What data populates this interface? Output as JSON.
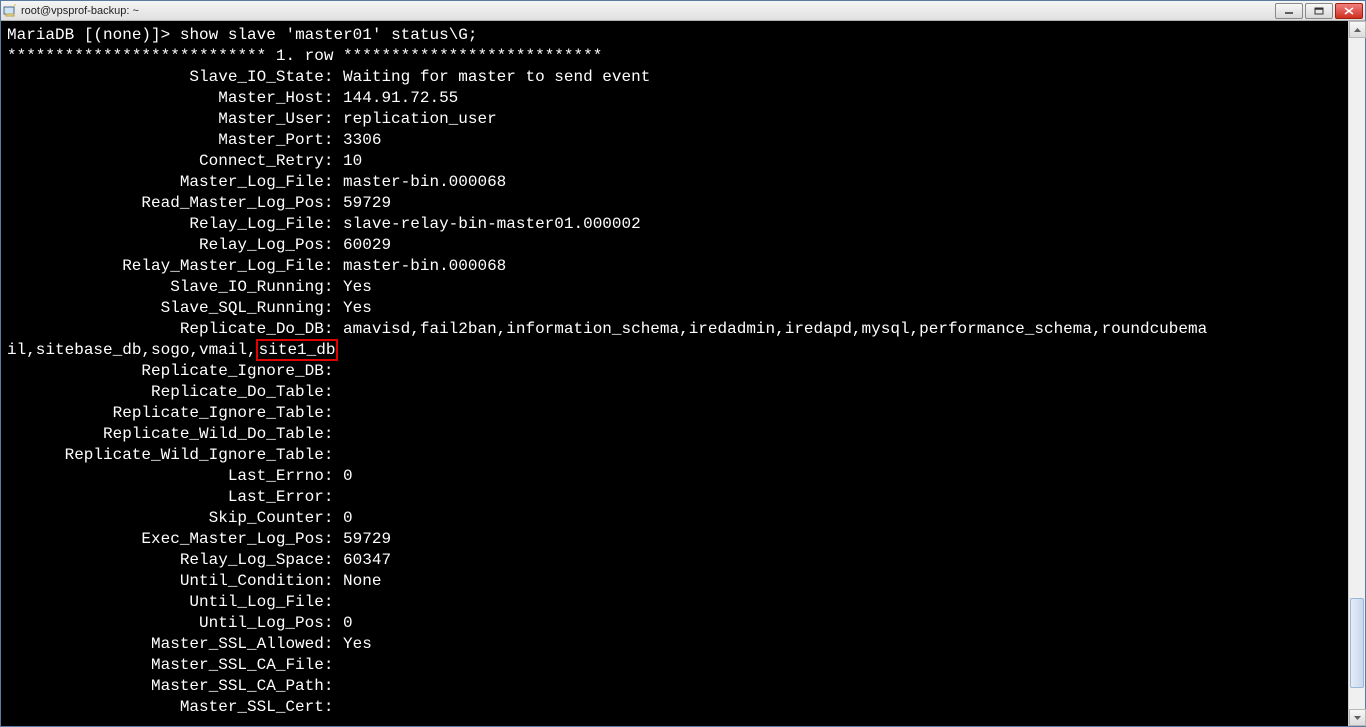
{
  "window": {
    "title": "root@vpsprof-backup: ~"
  },
  "prompt": {
    "label": "MariaDB [(none)]>",
    "command": "show slave 'master01' status\\G;"
  },
  "row_separator": "*************************** 1. row ***************************",
  "replicate_do_db_prefix": "amavisd,fail2ban,information_schema,iredadmin,iredapd,mysql,performance_schema,roundcubema",
  "replicate_do_db_wrap": "il,sitebase_db,sogo,vmail,",
  "replicate_do_db_highlight": "site1_db",
  "fields": {
    "Slave_IO_State": "Waiting for master to send event",
    "Master_Host": "144.91.72.55",
    "Master_User": "replication_user",
    "Master_Port": "3306",
    "Connect_Retry": "10",
    "Master_Log_File": "master-bin.000068",
    "Read_Master_Log_Pos": "59729",
    "Relay_Log_File": "slave-relay-bin-master01.000002",
    "Relay_Log_Pos": "60029",
    "Relay_Master_Log_File": "master-bin.000068",
    "Slave_IO_Running": "Yes",
    "Slave_SQL_Running": "Yes",
    "Replicate_Do_DB_key": "Replicate_Do_DB",
    "Replicate_Ignore_DB": "",
    "Replicate_Do_Table": "",
    "Replicate_Ignore_Table": "",
    "Replicate_Wild_Do_Table": "",
    "Replicate_Wild_Ignore_Table": "",
    "Last_Errno": "0",
    "Last_Error": "",
    "Skip_Counter": "0",
    "Exec_Master_Log_Pos": "59729",
    "Relay_Log_Space": "60347",
    "Until_Condition": "None",
    "Until_Log_File": "",
    "Until_Log_Pos": "0",
    "Master_SSL_Allowed": "Yes",
    "Master_SSL_CA_File": "",
    "Master_SSL_CA_Path": "",
    "Master_SSL_Cert": ""
  },
  "labels": {
    "Slave_IO_State": "Slave_IO_State",
    "Master_Host": "Master_Host",
    "Master_User": "Master_User",
    "Master_Port": "Master_Port",
    "Connect_Retry": "Connect_Retry",
    "Master_Log_File": "Master_Log_File",
    "Read_Master_Log_Pos": "Read_Master_Log_Pos",
    "Relay_Log_File": "Relay_Log_File",
    "Relay_Log_Pos": "Relay_Log_Pos",
    "Relay_Master_Log_File": "Relay_Master_Log_File",
    "Slave_IO_Running": "Slave_IO_Running",
    "Slave_SQL_Running": "Slave_SQL_Running",
    "Replicate_Ignore_DB": "Replicate_Ignore_DB",
    "Replicate_Do_Table": "Replicate_Do_Table",
    "Replicate_Ignore_Table": "Replicate_Ignore_Table",
    "Replicate_Wild_Do_Table": "Replicate_Wild_Do_Table",
    "Replicate_Wild_Ignore_Table": "Replicate_Wild_Ignore_Table",
    "Last_Errno": "Last_Errno",
    "Last_Error": "Last_Error",
    "Skip_Counter": "Skip_Counter",
    "Exec_Master_Log_Pos": "Exec_Master_Log_Pos",
    "Relay_Log_Space": "Relay_Log_Space",
    "Until_Condition": "Until_Condition",
    "Until_Log_File": "Until_Log_File",
    "Until_Log_Pos": "Until_Log_Pos",
    "Master_SSL_Allowed": "Master_SSL_Allowed",
    "Master_SSL_CA_File": "Master_SSL_CA_File",
    "Master_SSL_CA_Path": "Master_SSL_CA_Path",
    "Master_SSL_Cert": "Master_SSL_Cert"
  }
}
